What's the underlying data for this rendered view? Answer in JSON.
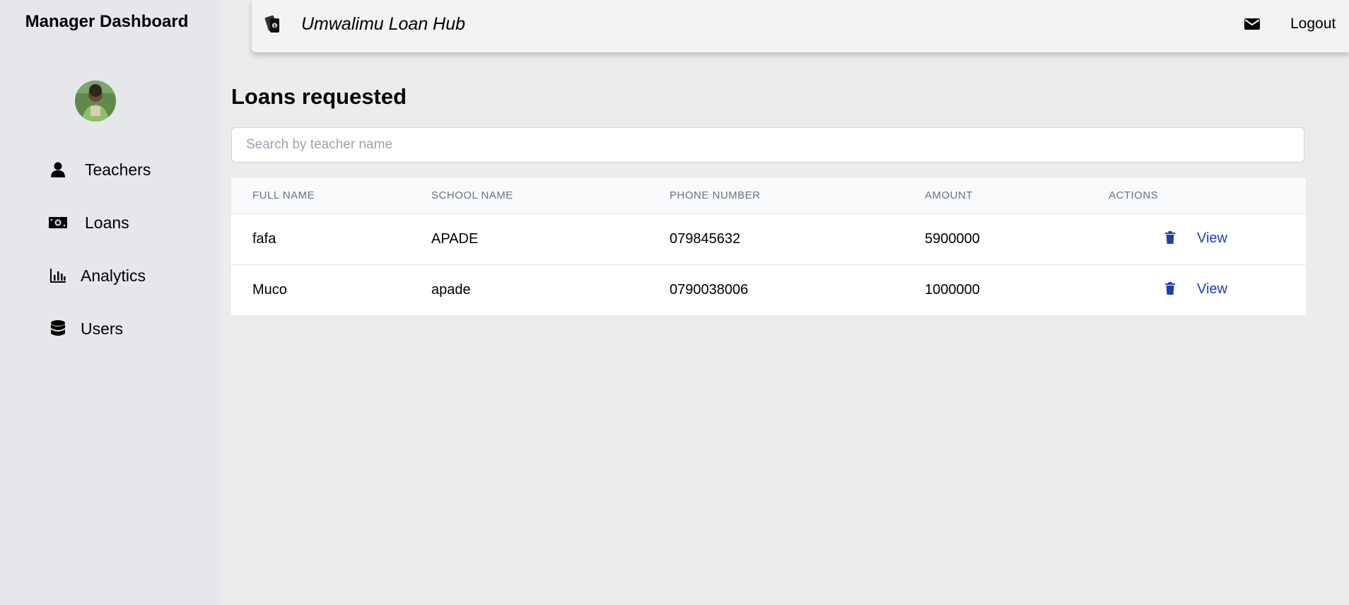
{
  "sidebar": {
    "title": "Manager Dashboard",
    "items": [
      {
        "label": "Teachers",
        "icon": "user-icon"
      },
      {
        "label": "Loans",
        "icon": "money-bill-icon"
      },
      {
        "label": "Analytics",
        "icon": "bar-chart-icon"
      },
      {
        "label": "Users",
        "icon": "database-icon"
      }
    ]
  },
  "header": {
    "brand_icon": "money-stack-icon",
    "title": "Umwalimu Loan Hub",
    "mail_icon": "envelope-icon",
    "logout_label": "Logout"
  },
  "main": {
    "title": "Loans requested",
    "search": {
      "placeholder": "Search by teacher name",
      "value": ""
    },
    "table": {
      "columns": [
        "FULL NAME",
        "SCHOOL NAME",
        "PHONE NUMBER",
        "AMOUNT",
        "ACTIONS"
      ],
      "rows": [
        {
          "full_name": "fafa",
          "school_name": "APADE",
          "phone": "079845632",
          "amount": "5900000",
          "view_label": "View"
        },
        {
          "full_name": "Muco",
          "school_name": "apade",
          "phone": "0790038006",
          "amount": "1000000",
          "view_label": "View"
        }
      ]
    }
  },
  "colors": {
    "sidebar_bg": "#e5e7eb",
    "page_bg": "#ececec",
    "accent": "#1e40af"
  }
}
